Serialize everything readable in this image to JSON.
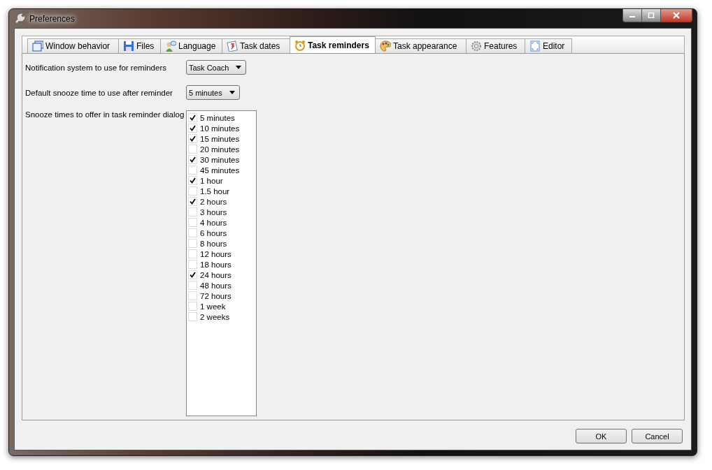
{
  "window": {
    "title": "Preferences"
  },
  "tabs": [
    {
      "label": "Window behavior",
      "selected": false
    },
    {
      "label": "Files",
      "selected": false
    },
    {
      "label": "Language",
      "selected": false
    },
    {
      "label": "Task dates",
      "selected": false
    },
    {
      "label": "Task reminders",
      "selected": true
    },
    {
      "label": "Task appearance",
      "selected": false
    },
    {
      "label": "Features",
      "selected": false
    },
    {
      "label": "Editor",
      "selected": false
    }
  ],
  "settings": [
    {
      "kind": "dropdown",
      "label": "Notification system to use for reminders",
      "value": "Task Coach"
    },
    {
      "kind": "dropdown",
      "label": "Default snooze time to use after reminder",
      "value": "5 minutes"
    },
    {
      "kind": "checklist",
      "label": "Snooze times to offer in task reminder dialog",
      "items": [
        {
          "label": "5 minutes",
          "checked": true
        },
        {
          "label": "10 minutes",
          "checked": true
        },
        {
          "label": "15 minutes",
          "checked": true
        },
        {
          "label": "20 minutes",
          "checked": false
        },
        {
          "label": "30 minutes",
          "checked": true
        },
        {
          "label": "45 minutes",
          "checked": false
        },
        {
          "label": "1 hour",
          "checked": true
        },
        {
          "label": "1.5 hour",
          "checked": false
        },
        {
          "label": "2 hours",
          "checked": true
        },
        {
          "label": "3 hours",
          "checked": false
        },
        {
          "label": "4 hours",
          "checked": false
        },
        {
          "label": "6 hours",
          "checked": false
        },
        {
          "label": "8 hours",
          "checked": false
        },
        {
          "label": "12 hours",
          "checked": false
        },
        {
          "label": "18 hours",
          "checked": false
        },
        {
          "label": "24 hours",
          "checked": true
        },
        {
          "label": "48 hours",
          "checked": false
        },
        {
          "label": "72 hours",
          "checked": false
        },
        {
          "label": "1 week",
          "checked": false
        },
        {
          "label": "2 weeks",
          "checked": false
        }
      ]
    }
  ],
  "buttons": [
    "OK",
    "Cancel"
  ]
}
